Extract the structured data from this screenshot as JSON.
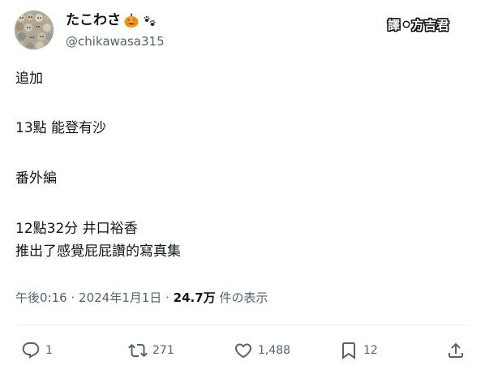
{
  "author": {
    "display_name": "たこわさ",
    "emojis": [
      "pumpkin-icon",
      "paw-prints-icon"
    ],
    "handle": "@chikawasa315"
  },
  "translator": {
    "prefix": "譯",
    "name": "方吉君"
  },
  "tweet": {
    "lines": [
      "追加",
      "13點 能登有沙",
      "番外編",
      "12點32分 井口裕香",
      "推出了感覺屁屁讚的寫真集"
    ]
  },
  "meta": {
    "time": "午後0:16",
    "separator": "·",
    "date": "2024年1月1日",
    "views_count": "24.7万",
    "views_label": "件の表示"
  },
  "actions": {
    "reply_count": "1",
    "retweet_count": "271",
    "like_count": "1,488",
    "bookmark_count": "12"
  },
  "colors": {
    "text_primary": "#0f1419",
    "text_secondary": "#536471",
    "divider": "#eff3f4"
  }
}
